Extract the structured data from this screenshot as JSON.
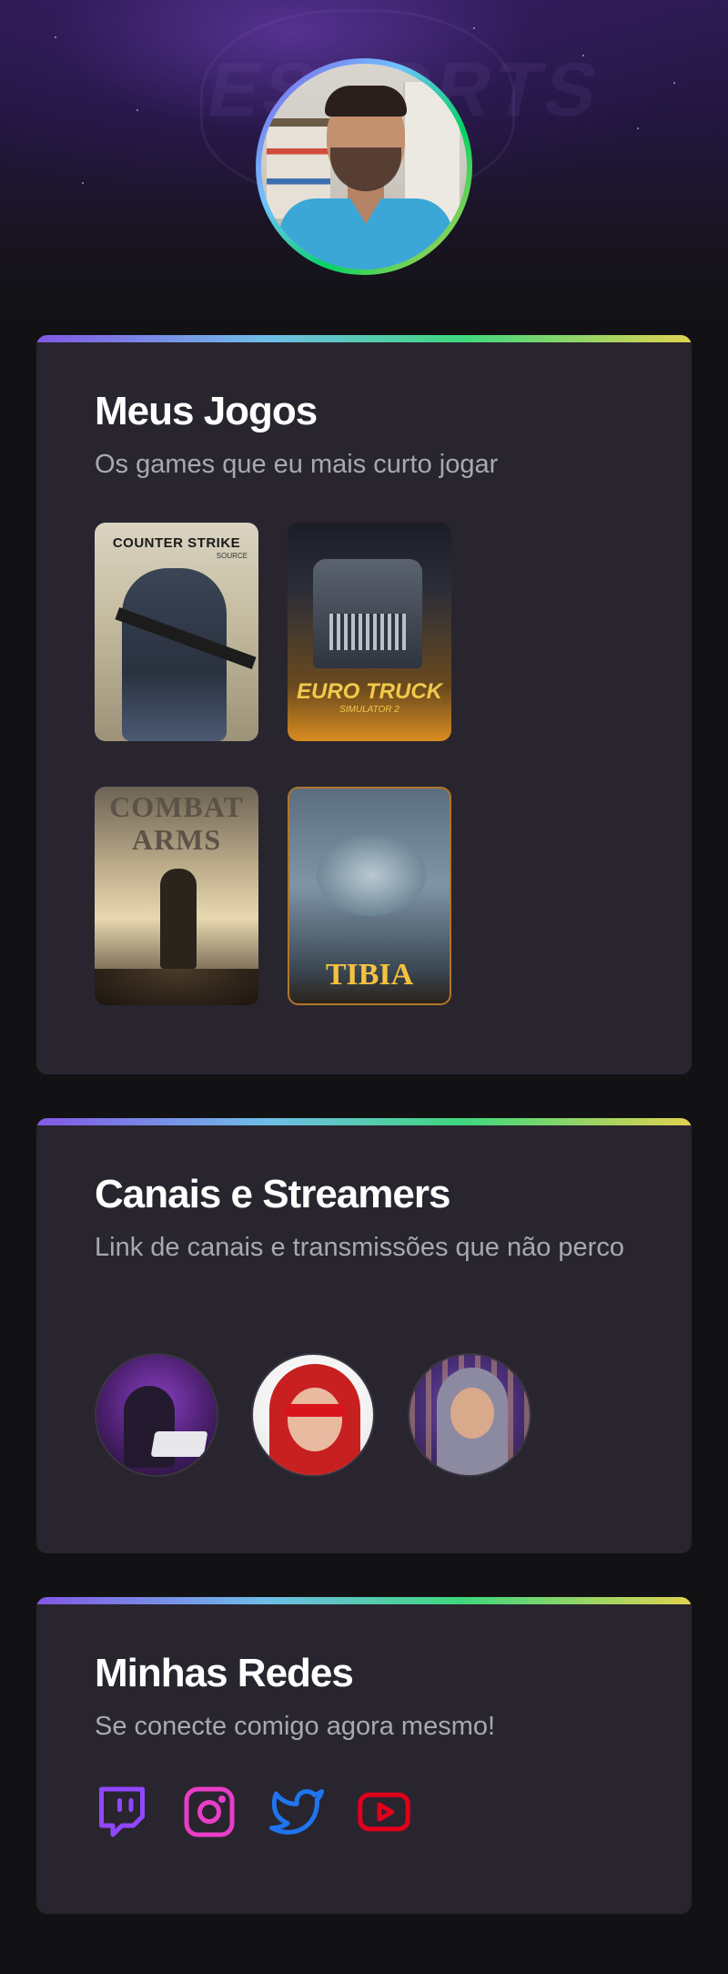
{
  "profile": {
    "avatar_name": "avatar",
    "hero_emblem": "ESPORTS"
  },
  "games_section": {
    "title": "Meus Jogos",
    "subtitle": "Os games que eu mais curto jogar",
    "games": [
      {
        "title": "COUNTER STRIKE",
        "subtitle": "SOURCE"
      },
      {
        "title": "EURO TRUCK",
        "subtitle": "SIMULATOR 2"
      },
      {
        "title": "COMBAT ARMS"
      },
      {
        "title": "TIBIA"
      }
    ]
  },
  "streamers_section": {
    "title": "Canais e Streamers",
    "subtitle": "Link de canais e transmissões que não perco"
  },
  "socials_section": {
    "title": "Minhas Redes",
    "subtitle": "Se conecte comigo agora mesmo!",
    "links": [
      {
        "icon": "twitch-icon",
        "color": "#9147ff"
      },
      {
        "icon": "instagram-icon",
        "color": "#e93dc6"
      },
      {
        "icon": "twitter-icon",
        "color": "#1f74f0"
      },
      {
        "icon": "youtube-icon",
        "color": "#e2001a"
      }
    ]
  },
  "colors": {
    "background": "#121214",
    "card": "#29252f",
    "accent_gradient": [
      "#8257e5",
      "#6fbde8",
      "#3fd77e",
      "#e1d250"
    ],
    "subtitle_text": "#a8a8b3"
  }
}
